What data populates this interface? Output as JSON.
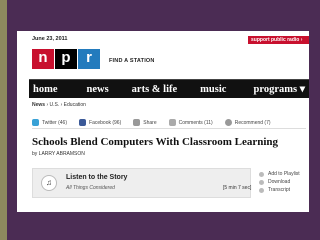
{
  "page": {
    "date": "June 23, 2011",
    "support_label": "support public radio ›",
    "logo_letters": [
      "n",
      "p",
      "r"
    ],
    "find_station": "FIND A STATION"
  },
  "nav": {
    "items": [
      "home",
      "news",
      "arts & life",
      "music",
      "programs ▾"
    ]
  },
  "breadcrumb": {
    "section": "News",
    "path": "› U.S. › Education"
  },
  "share": {
    "twitter": "Twitter (46)",
    "facebook": "Facebook (96)",
    "share": "Share",
    "comments": "Comments (11)",
    "recommend": "Recommend (7)"
  },
  "article": {
    "headline": "Schools Blend Computers With Classroom Learning",
    "byline": "by LARRY ABRAMSON"
  },
  "player": {
    "title": "Listen to the Story",
    "program": "All Things Considered",
    "duration": "[5 min 7 sec]"
  },
  "side_links": [
    "Add to Playlist",
    "Download",
    "Transcript"
  ],
  "colors": {
    "frame_purple": "#4b2c54",
    "frame_olive": "#8d8a5e",
    "npr_red": "#c8102e",
    "npr_blue": "#237bbd",
    "nav_bg": "#111111"
  }
}
